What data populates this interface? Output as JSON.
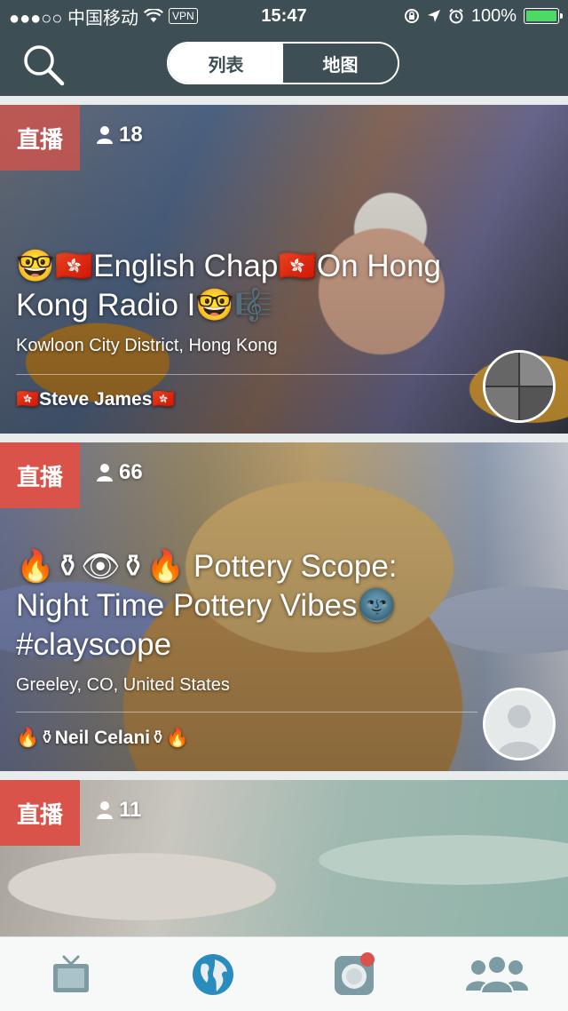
{
  "status_bar": {
    "carrier": "●●●○○ 中国移动",
    "vpn": "VPN",
    "time": "15:47",
    "battery": "100%"
  },
  "nav": {
    "segments": [
      {
        "label": "列表",
        "active": true
      },
      {
        "label": "地图",
        "active": false
      }
    ]
  },
  "feed": {
    "cards": [
      {
        "badge": "直播",
        "viewers": "18",
        "title": "🤓🇭🇰English Chap🇭🇰On Hong Kong Radio I🤓🎼",
        "location": "Kowloon City District, Hong Kong",
        "broadcaster": "🇭🇰Steve James🇭🇰"
      },
      {
        "badge": "直播",
        "viewers": "66",
        "title": "🔥⚱👁⚱🔥 Pottery Scope: Night Time Pottery Vibes🌚 #clayscope",
        "location": "Greeley, CO, United States",
        "broadcaster": "🔥⚱Neil Celani⚱🔥"
      },
      {
        "badge": "直播",
        "viewers": "11"
      }
    ]
  },
  "colors": {
    "header": "#3d4f55",
    "live_badge": "#d9534a",
    "accent": "#2a8bbf"
  },
  "tab_bar": {
    "tabs": [
      "tv-icon",
      "globe-icon",
      "camera-icon",
      "people-icon"
    ],
    "active_tab": "globe-icon"
  }
}
